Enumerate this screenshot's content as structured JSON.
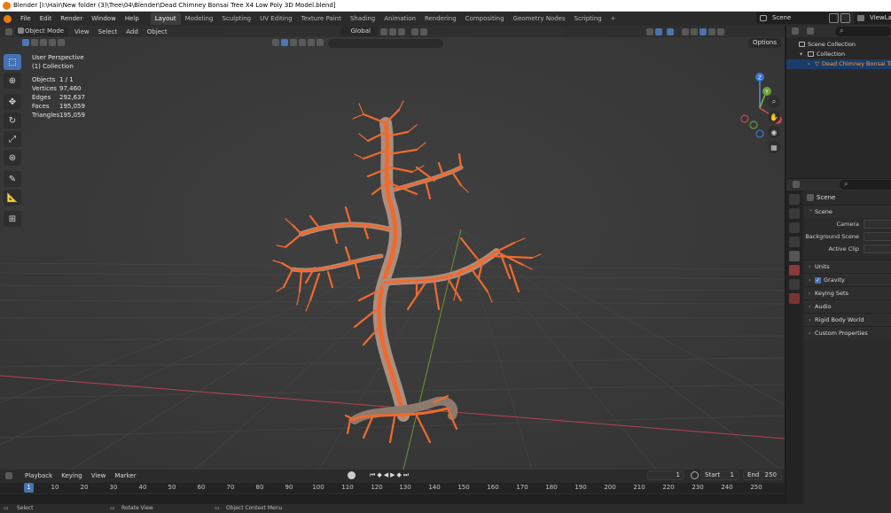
{
  "window": {
    "title": "Blender [I:\\Hair\\New folder (3)\\Tree\\04\\Blender\\Dead Chimney Bonsai Tree X4 Low Poly 3D Model.blend]"
  },
  "topbar": {
    "menus": [
      "File",
      "Edit",
      "Render",
      "Window",
      "Help"
    ],
    "workspaces": [
      "Layout",
      "Modeling",
      "Sculpting",
      "UV Editing",
      "Texture Paint",
      "Shading",
      "Animation",
      "Rendering",
      "Compositing",
      "Geometry Nodes",
      "Scripting"
    ],
    "active_workspace": "Layout",
    "add_label": "+",
    "scene": "Scene",
    "view_layer": "ViewLa"
  },
  "viewport": {
    "mode": "Object Mode",
    "menus": [
      "View",
      "Select",
      "Add",
      "Object"
    ],
    "orientation": "Global",
    "options_label": "Options",
    "view_name": "User Perspective",
    "collection_name": "(1) Collection",
    "stats": [
      {
        "label": "Objects",
        "value": "1 / 1"
      },
      {
        "label": "Vertices",
        "value": "97,460"
      },
      {
        "label": "Edges",
        "value": "292,637"
      },
      {
        "label": "Faces",
        "value": "195,059"
      },
      {
        "label": "Triangles",
        "value": "195,059"
      }
    ],
    "gizmo_labels": {
      "z": "Z",
      "y": "Y",
      "x": "X"
    },
    "object_color": "#ef6a2f",
    "x_axis_color": "#b5434c",
    "y_axis_color": "#6c9533"
  },
  "timeline": {
    "menus": [
      "Playback",
      "Keying",
      "View",
      "Marker"
    ],
    "current_frame": "1",
    "start_label": "Start",
    "start": "1",
    "end_label": "End",
    "end": "250",
    "ticks": [
      "1",
      "10",
      "20",
      "30",
      "40",
      "50",
      "60",
      "70",
      "80",
      "90",
      "100",
      "110",
      "120",
      "130",
      "140",
      "150",
      "160",
      "170",
      "180",
      "190",
      "200",
      "210",
      "220",
      "230",
      "240",
      "250"
    ]
  },
  "statusbar": {
    "select": "Select",
    "rotate": "Rotate View",
    "context": "Object Context Menu"
  },
  "outliner": {
    "root": "Scene Collection",
    "collection": "Collection",
    "object": "Dead Chimney Bonsai Tree"
  },
  "properties": {
    "context": "Scene",
    "panel_title": "Scene",
    "fields": [
      "Camera",
      "Background Scene",
      "Active Clip"
    ],
    "panels": [
      "Units",
      "Gravity",
      "Keying Sets",
      "Audio",
      "Rigid Body World",
      "Custom Properties"
    ],
    "accent": "#4772b3"
  }
}
